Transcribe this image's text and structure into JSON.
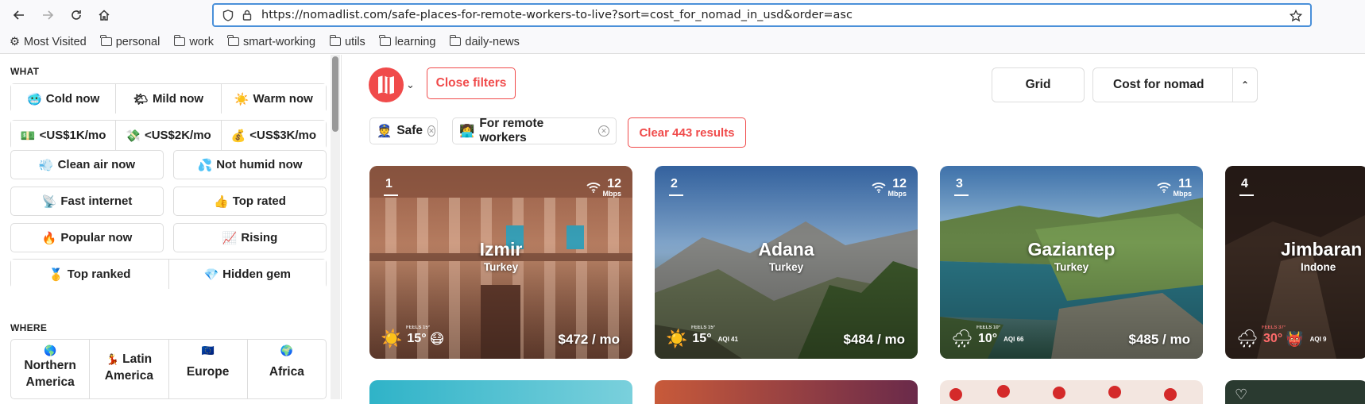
{
  "browser": {
    "url": "https://nomadlist.com/safe-places-for-remote-workers-to-live?sort=cost_for_nomad_in_usd&order=asc",
    "bookmarks": [
      {
        "label": "Most Visited",
        "icon": "gear-icon"
      },
      {
        "label": "personal",
        "icon": "folder-icon"
      },
      {
        "label": "work",
        "icon": "folder-icon"
      },
      {
        "label": "smart-working",
        "icon": "folder-icon"
      },
      {
        "label": "utils",
        "icon": "folder-icon"
      },
      {
        "label": "learning",
        "icon": "folder-icon"
      },
      {
        "label": "daily-news",
        "icon": "folder-icon"
      }
    ]
  },
  "sidebar": {
    "what_label": "WHAT",
    "where_label": "WHERE",
    "filters": {
      "row1": [
        {
          "emoji": "🥶",
          "label": "Cold now"
        },
        {
          "emoji": "🌤",
          "label": "Mild now"
        },
        {
          "emoji": "☀️",
          "label": "Warm now"
        }
      ],
      "row2": [
        {
          "emoji": "💵",
          "label": "<US$1K/mo"
        },
        {
          "emoji": "💸",
          "label": "<US$2K/mo"
        },
        {
          "emoji": "💰",
          "label": "<US$3K/mo"
        }
      ],
      "row3": [
        {
          "emoji": "💨",
          "label": "Clean air now"
        },
        {
          "emoji": "💦",
          "label": "Not humid now"
        }
      ],
      "row4": [
        {
          "emoji": "📡",
          "label": "Fast internet"
        },
        {
          "emoji": "👍",
          "label": "Top rated"
        }
      ],
      "row5": [
        {
          "emoji": "🔥",
          "label": "Popular now"
        },
        {
          "emoji": "📈",
          "label": "Rising"
        }
      ],
      "row6": [
        {
          "emoji": "🥇",
          "label": "Top ranked"
        },
        {
          "emoji": "💎",
          "label": "Hidden gem"
        }
      ]
    },
    "regions": [
      {
        "emoji": "🌎",
        "label": "Northern America"
      },
      {
        "emoji": "💃",
        "label": "Latin America"
      },
      {
        "emoji": "🇪🇺",
        "label": "Europe"
      },
      {
        "emoji": "🌍",
        "label": "Africa"
      }
    ]
  },
  "main": {
    "close_filters": "Close filters",
    "view_grid": "Grid",
    "sort_label": "Cost for nomad",
    "sort_caret": "⌃",
    "chips": [
      {
        "emoji": "👮",
        "label": "Safe"
      },
      {
        "emoji": "👩‍💻",
        "label": "For remote workers"
      }
    ],
    "clear_results": "Clear 443 results",
    "cards": [
      {
        "rank": "1",
        "speed": "12",
        "speed_unit": "Mbps",
        "city": "Izmir",
        "country": "Turkey",
        "price": "$472 / mo",
        "temp": "15°",
        "feels": "FEELS 15°",
        "weather_icon": "☀️",
        "aqi_icon": "😷",
        "aqi": ""
      },
      {
        "rank": "2",
        "speed": "12",
        "speed_unit": "Mbps",
        "city": "Adana",
        "country": "Turkey",
        "price": "$484 / mo",
        "temp": "15°",
        "feels": "FEELS 15°",
        "weather_icon": "☀️",
        "aqi_icon": "",
        "aqi": "AQI 41"
      },
      {
        "rank": "3",
        "speed": "11",
        "speed_unit": "Mbps",
        "city": "Gaziantep",
        "country": "Turkey",
        "price": "$485 / mo",
        "temp": "10°",
        "feels": "FEELS 10°",
        "weather_icon": "🌧",
        "aqi_icon": "",
        "aqi": "AQI 66"
      },
      {
        "rank": "4",
        "speed": "",
        "speed_unit": "",
        "city": "Jimbaran",
        "country": "Indone",
        "price": "",
        "temp": "30°",
        "feels": "FEELS 37°",
        "weather_icon": "🌧",
        "aqi_icon": "👹",
        "aqi": "AQI 9"
      }
    ]
  }
}
